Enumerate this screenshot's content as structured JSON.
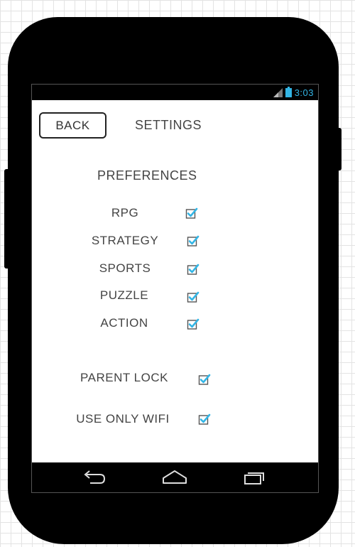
{
  "status_bar": {
    "time": "3:03",
    "icons": [
      "signal-icon",
      "battery-icon"
    ],
    "accent_color": "#33b5e5"
  },
  "header": {
    "back_label": "BACK",
    "title": "SETTINGS"
  },
  "preferences": {
    "heading": "PREFERENCES",
    "items": [
      {
        "label": "RPG",
        "checked": true
      },
      {
        "label": "STRATEGY",
        "checked": true
      },
      {
        "label": "SPORTS",
        "checked": true
      },
      {
        "label": "PUZZLE",
        "checked": true
      },
      {
        "label": "ACTION",
        "checked": true
      }
    ]
  },
  "options": {
    "items": [
      {
        "label": "PARENT LOCK",
        "checked": true
      },
      {
        "label": "USE ONLY WIFI",
        "checked": true
      }
    ]
  },
  "nav_bar": {
    "icons": [
      "back-arrow-icon",
      "home-icon",
      "recent-apps-icon"
    ]
  }
}
